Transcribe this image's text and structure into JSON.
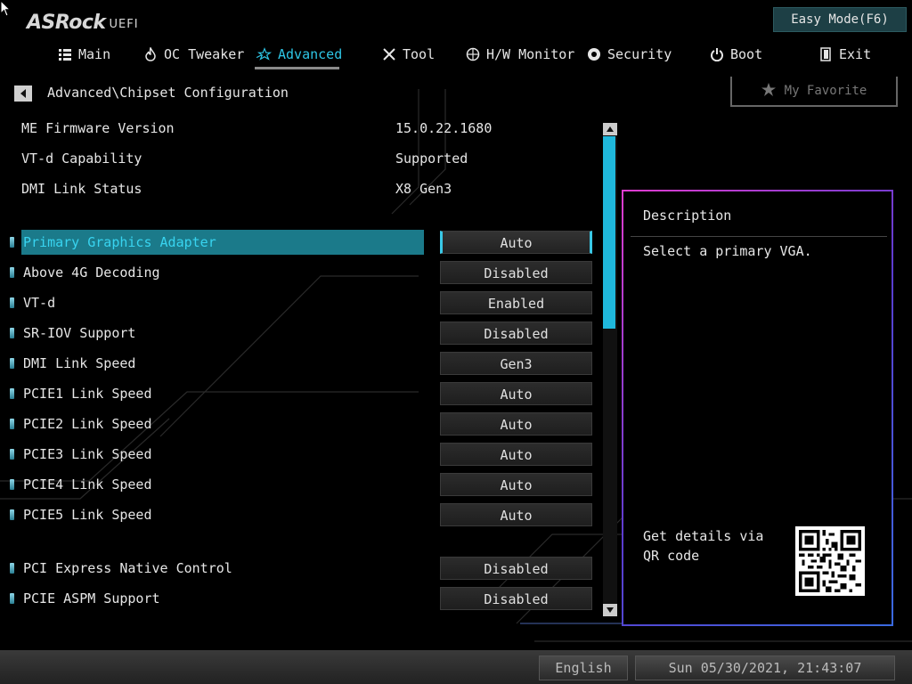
{
  "header": {
    "logo_main": "ASRock",
    "logo_sub": "UEFI",
    "easy_mode_label": "Easy Mode(F6)"
  },
  "tabs": [
    {
      "label": "Main",
      "icon": "list-icon",
      "active": false
    },
    {
      "label": "OC Tweaker",
      "icon": "flame-icon",
      "active": false
    },
    {
      "label": "Advanced",
      "icon": "star-icon",
      "active": true
    },
    {
      "label": "Tool",
      "icon": "tools-icon",
      "active": false
    },
    {
      "label": "H/W Monitor",
      "icon": "monitor-icon",
      "active": false
    },
    {
      "label": "Security",
      "icon": "shield-icon",
      "active": false
    },
    {
      "label": "Boot",
      "icon": "power-icon",
      "active": false
    },
    {
      "label": "Exit",
      "icon": "exit-icon",
      "active": false
    }
  ],
  "breadcrumb": "Advanced\\Chipset Configuration",
  "favorite_label": "My Favorite",
  "info": [
    {
      "key": "ME Firmware Version",
      "value": "15.0.22.1680"
    },
    {
      "key": "VT-d Capability",
      "value": "Supported"
    },
    {
      "key": "DMI Link Status",
      "value": "X8  Gen3"
    }
  ],
  "settings": [
    {
      "label": "Primary Graphics Adapter",
      "value": "Auto",
      "selected": true
    },
    {
      "label": "Above 4G Decoding",
      "value": "Disabled"
    },
    {
      "label": "VT-d",
      "value": "Enabled"
    },
    {
      "label": "SR-IOV Support",
      "value": "Disabled"
    },
    {
      "label": "DMI Link Speed",
      "value": "Gen3"
    },
    {
      "label": "PCIE1 Link Speed",
      "value": "Auto"
    },
    {
      "label": "PCIE2 Link Speed",
      "value": "Auto"
    },
    {
      "label": "PCIE3 Link Speed",
      "value": "Auto"
    },
    {
      "label": "PCIE4 Link Speed",
      "value": "Auto"
    },
    {
      "label": "PCIE5 Link Speed",
      "value": "Auto"
    },
    {
      "label": "PCI Express Native Control",
      "value": "Disabled"
    },
    {
      "label": "PCIE ASPM Support",
      "value": "Disabled"
    }
  ],
  "description": {
    "title": "Description",
    "text": "Select a primary VGA.",
    "qr_text": "Get details via QR code"
  },
  "footer": {
    "language": "English",
    "datetime": "Sun 05/30/2021, 21:43:07"
  },
  "colors": {
    "accent": "#2ec6e6",
    "selected_row": "#1b7a8a",
    "easy_mode_bg": "#1d3f45"
  }
}
